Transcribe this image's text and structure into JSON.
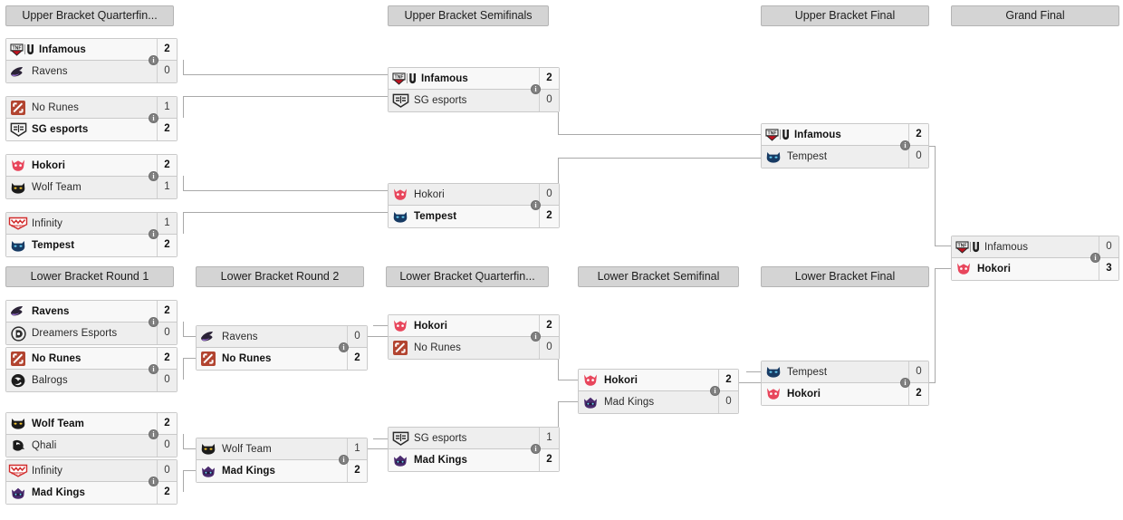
{
  "page": {
    "title": "Tournament Bracket",
    "background": "#ffffff",
    "line_color": "#a9a9a9",
    "header_bg": "#d4d4d4",
    "winner_row_bg": "#f8f8f8",
    "loser_row_bg": "#eeeeee",
    "info_icon": "info-icon",
    "info_glyph": "i"
  },
  "rounds": [
    {
      "id": "ubqf",
      "label": "Upper Bracket Quarterfin..."
    },
    {
      "id": "ubsf",
      "label": "Upper Bracket Semifinals"
    },
    {
      "id": "ubf",
      "label": "Upper Bracket Final"
    },
    {
      "id": "gf",
      "label": "Grand Final"
    },
    {
      "id": "lbr1",
      "label": "Lower Bracket Round 1"
    },
    {
      "id": "lbr2",
      "label": "Lower Bracket Round 2"
    },
    {
      "id": "lbqf",
      "label": "Lower Bracket Quarterfin..."
    },
    {
      "id": "lbsf",
      "label": "Lower Bracket Semifinal"
    },
    {
      "id": "lbf",
      "label": "Lower Bracket Final"
    }
  ],
  "matches": {
    "ubqf1": {
      "round": "ubqf",
      "teams": [
        {
          "name": "Infamous",
          "score": "2",
          "winner": true,
          "logo": "infamous-logo"
        },
        {
          "name": "Ravens",
          "score": "0",
          "winner": false,
          "logo": "ravens-logo"
        }
      ]
    },
    "ubqf2": {
      "round": "ubqf",
      "teams": [
        {
          "name": "No Runes",
          "score": "1",
          "winner": false,
          "logo": "no-runes-logo"
        },
        {
          "name": "SG esports",
          "score": "2",
          "winner": true,
          "logo": "sg-esports-logo"
        }
      ]
    },
    "ubqf3": {
      "round": "ubqf",
      "teams": [
        {
          "name": "Hokori",
          "score": "2",
          "winner": true,
          "logo": "hokori-logo"
        },
        {
          "name": "Wolf Team",
          "score": "1",
          "winner": false,
          "logo": "wolf-team-logo"
        }
      ]
    },
    "ubqf4": {
      "round": "ubqf",
      "teams": [
        {
          "name": "Infinity",
          "score": "1",
          "winner": false,
          "logo": "infinity-logo"
        },
        {
          "name": "Tempest",
          "score": "2",
          "winner": true,
          "logo": "tempest-logo"
        }
      ]
    },
    "ubsf1": {
      "round": "ubsf",
      "teams": [
        {
          "name": "Infamous",
          "score": "2",
          "winner": true,
          "logo": "infamous-logo"
        },
        {
          "name": "SG esports",
          "score": "0",
          "winner": false,
          "logo": "sg-esports-logo"
        }
      ]
    },
    "ubsf2": {
      "round": "ubsf",
      "teams": [
        {
          "name": "Hokori",
          "score": "0",
          "winner": false,
          "logo": "hokori-logo"
        },
        {
          "name": "Tempest",
          "score": "2",
          "winner": true,
          "logo": "tempest-logo"
        }
      ]
    },
    "ubf1": {
      "round": "ubf",
      "teams": [
        {
          "name": "Infamous",
          "score": "2",
          "winner": true,
          "logo": "infamous-logo"
        },
        {
          "name": "Tempest",
          "score": "0",
          "winner": false,
          "logo": "tempest-logo"
        }
      ]
    },
    "gf1": {
      "round": "gf",
      "teams": [
        {
          "name": "Infamous",
          "score": "0",
          "winner": false,
          "logo": "infamous-logo"
        },
        {
          "name": "Hokori",
          "score": "3",
          "winner": true,
          "logo": "hokori-logo"
        }
      ]
    },
    "lbr1a": {
      "round": "lbr1",
      "teams": [
        {
          "name": "Ravens",
          "score": "2",
          "winner": true,
          "logo": "ravens-logo"
        },
        {
          "name": "Dreamers Esports",
          "score": "0",
          "winner": false,
          "logo": "dreamers-esports-logo"
        }
      ]
    },
    "lbr1b": {
      "round": "lbr1",
      "teams": [
        {
          "name": "No Runes",
          "score": "2",
          "winner": true,
          "logo": "no-runes-logo"
        },
        {
          "name": "Balrogs",
          "score": "0",
          "winner": false,
          "logo": "balrogs-logo"
        }
      ]
    },
    "lbr1c": {
      "round": "lbr1",
      "teams": [
        {
          "name": "Wolf Team",
          "score": "2",
          "winner": true,
          "logo": "wolf-team-logo"
        },
        {
          "name": "Qhali",
          "score": "0",
          "winner": false,
          "logo": "qhali-logo"
        }
      ]
    },
    "lbr1d": {
      "round": "lbr1",
      "teams": [
        {
          "name": "Infinity",
          "score": "0",
          "winner": false,
          "logo": "infinity-logo"
        },
        {
          "name": "Mad Kings",
          "score": "2",
          "winner": true,
          "logo": "mad-kings-logo"
        }
      ]
    },
    "lbr2a": {
      "round": "lbr2",
      "teams": [
        {
          "name": "Ravens",
          "score": "0",
          "winner": false,
          "logo": "ravens-logo"
        },
        {
          "name": "No Runes",
          "score": "2",
          "winner": true,
          "logo": "no-runes-logo"
        }
      ]
    },
    "lbr2b": {
      "round": "lbr2",
      "teams": [
        {
          "name": "Wolf Team",
          "score": "1",
          "winner": false,
          "logo": "wolf-team-logo"
        },
        {
          "name": "Mad Kings",
          "score": "2",
          "winner": true,
          "logo": "mad-kings-logo"
        }
      ]
    },
    "lbqf1": {
      "round": "lbqf",
      "teams": [
        {
          "name": "Hokori",
          "score": "2",
          "winner": true,
          "logo": "hokori-logo"
        },
        {
          "name": "No Runes",
          "score": "0",
          "winner": false,
          "logo": "no-runes-logo"
        }
      ]
    },
    "lbqf2": {
      "round": "lbqf",
      "teams": [
        {
          "name": "SG esports",
          "score": "1",
          "winner": false,
          "logo": "sg-esports-logo"
        },
        {
          "name": "Mad Kings",
          "score": "2",
          "winner": true,
          "logo": "mad-kings-logo"
        }
      ]
    },
    "lbsf1": {
      "round": "lbsf",
      "teams": [
        {
          "name": "Hokori",
          "score": "2",
          "winner": true,
          "logo": "hokori-logo"
        },
        {
          "name": "Mad Kings",
          "score": "0",
          "winner": false,
          "logo": "mad-kings-logo"
        }
      ]
    },
    "lbf1": {
      "round": "lbf",
      "teams": [
        {
          "name": "Tempest",
          "score": "0",
          "winner": false,
          "logo": "tempest-logo"
        },
        {
          "name": "Hokori",
          "score": "2",
          "winner": true,
          "logo": "hokori-logo"
        }
      ]
    }
  }
}
